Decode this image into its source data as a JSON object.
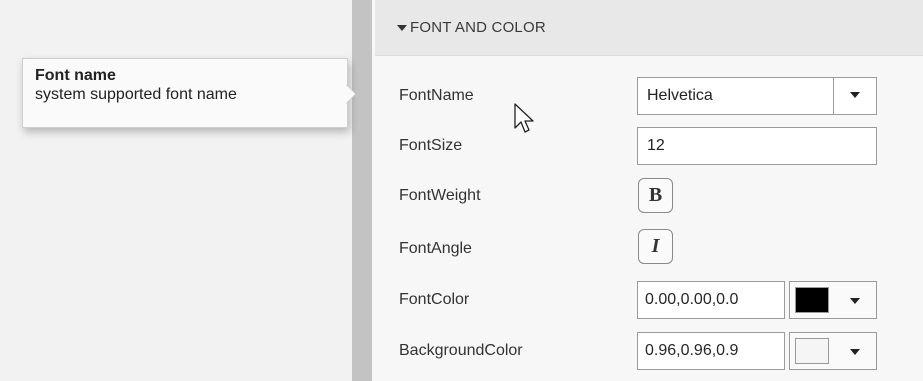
{
  "section": {
    "title": "FONT AND COLOR",
    "expand_icon": "caret-down-icon"
  },
  "properties": {
    "font_name": {
      "label": "FontName",
      "value": "Helvetica"
    },
    "font_size": {
      "label": "FontSize",
      "value": "12"
    },
    "font_weight": {
      "label": "FontWeight",
      "button_glyph": "B"
    },
    "font_angle": {
      "label": "FontAngle",
      "button_glyph": "I"
    },
    "font_color": {
      "label": "FontColor",
      "value": "0.00,0.00,0.0",
      "swatch_color": "#000000"
    },
    "background_color": {
      "label": "BackgroundColor",
      "value": "0.96,0.96,0.9",
      "swatch_color": "#f5f5f5"
    }
  },
  "tooltip": {
    "title": "Font name",
    "description": "system supported font name"
  },
  "cursor_icon": "mouse-pointer-icon"
}
